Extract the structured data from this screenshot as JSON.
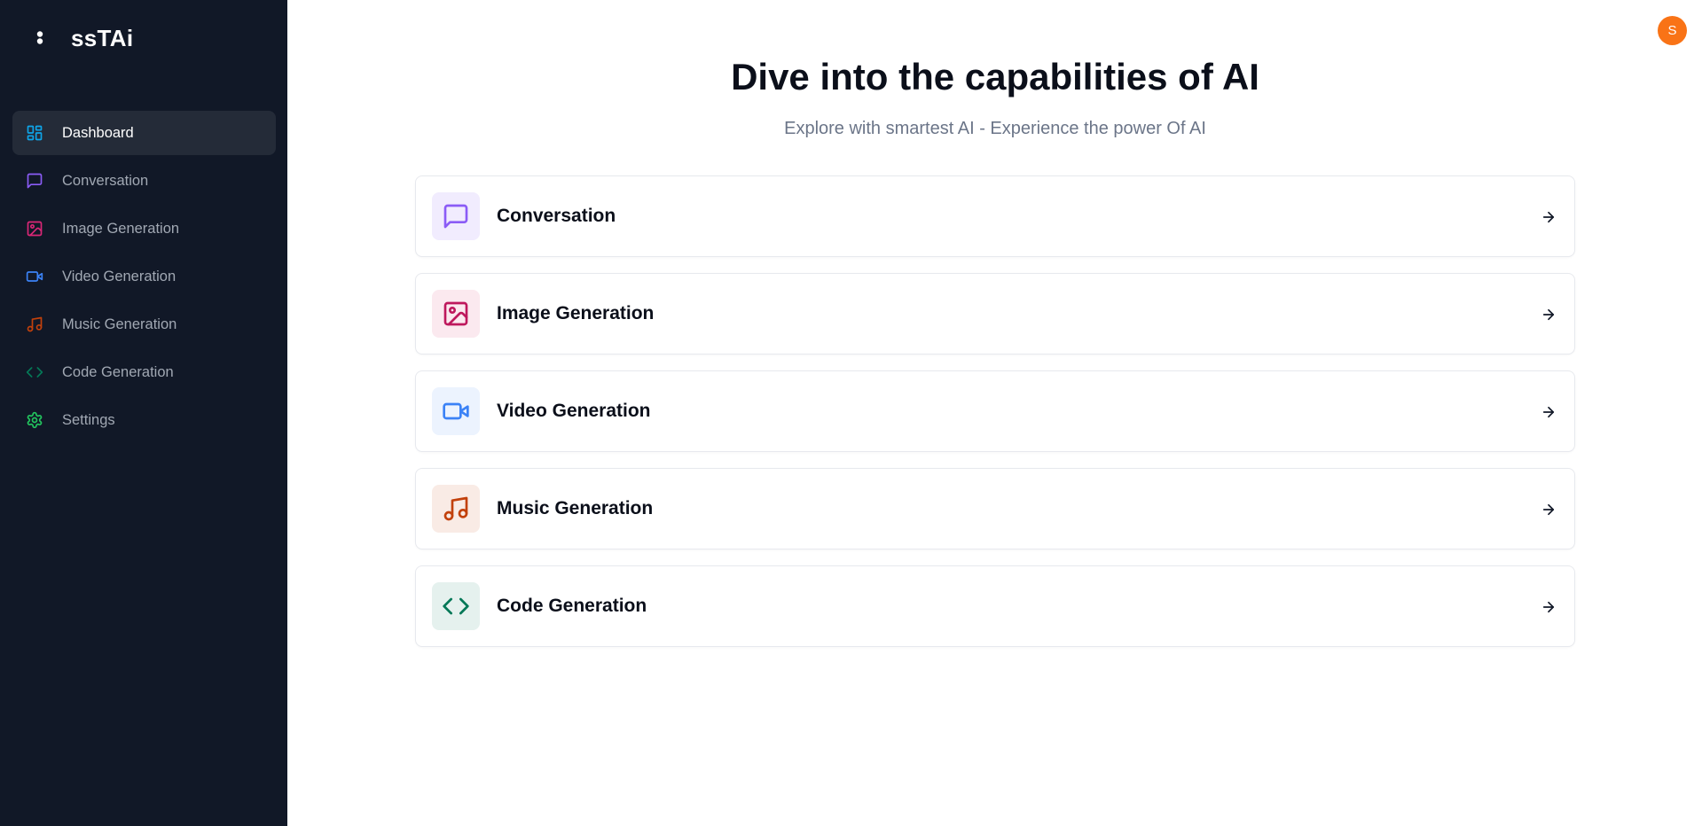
{
  "app": {
    "name": "ssTAi"
  },
  "user": {
    "avatar_initial": "S",
    "avatar_color": "#f97316"
  },
  "sidebar": {
    "items": [
      {
        "label": "Dashboard",
        "icon": "dashboard-icon",
        "color": "#0ea5e9",
        "active": true
      },
      {
        "label": "Conversation",
        "icon": "message-square-icon",
        "color": "#8b5cf6"
      },
      {
        "label": "Image Generation",
        "icon": "image-icon",
        "color": "#db2777"
      },
      {
        "label": "Video Generation",
        "icon": "video-icon",
        "color": "#3b82f6"
      },
      {
        "label": "Music Generation",
        "icon": "music-icon",
        "color": "#c2410c"
      },
      {
        "label": "Code Generation",
        "icon": "code-icon",
        "color": "#047857"
      },
      {
        "label": "Settings",
        "icon": "gear-icon",
        "color": "#22c55e"
      }
    ]
  },
  "main": {
    "title": "Dive into the capabilities of AI",
    "subtitle": "Explore with smartest AI - Experience the power Of AI",
    "tools": [
      {
        "label": "Conversation",
        "icon": "message-square-icon",
        "color": "#8b5cf6",
        "bg": "#f1ecfe"
      },
      {
        "label": "Image Generation",
        "icon": "image-icon",
        "color": "#be185d",
        "bg": "#fbe9ef"
      },
      {
        "label": "Video Generation",
        "icon": "video-icon",
        "color": "#3b82f6",
        "bg": "#ecf3fe"
      },
      {
        "label": "Music Generation",
        "icon": "music-icon",
        "color": "#c2410c",
        "bg": "#f9ebe5"
      },
      {
        "label": "Code Generation",
        "icon": "code-icon",
        "color": "#047857",
        "bg": "#e5f1ee"
      }
    ]
  }
}
